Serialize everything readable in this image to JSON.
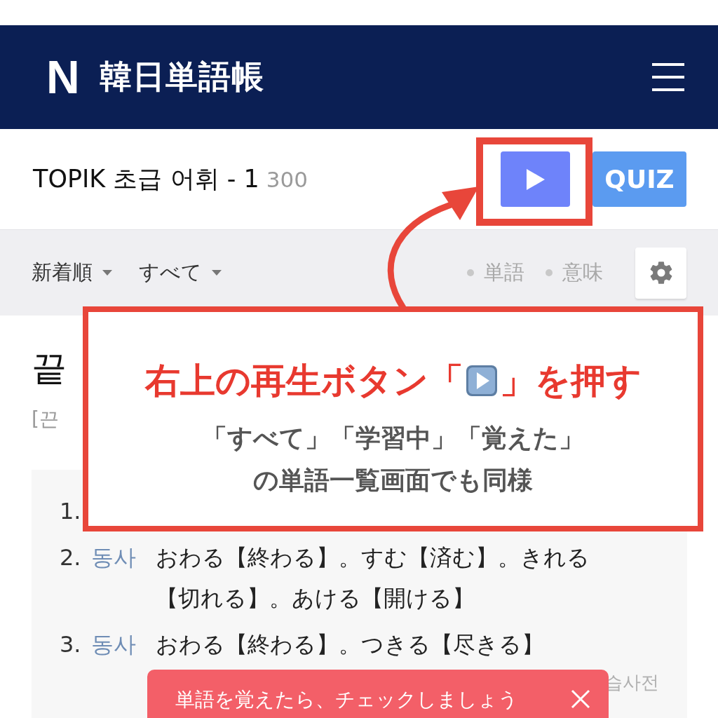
{
  "header": {
    "logo": "N",
    "title": "韓日単語帳"
  },
  "wordbook": {
    "title": "TOPIK 초급 어휘 - 1",
    "count": "300",
    "quiz_button": "QUIZ"
  },
  "filters": {
    "sort": "新着順",
    "status": "すべて",
    "toggles": [
      "単語",
      "意味"
    ]
  },
  "word": {
    "headword": "끝",
    "pronunciation": "[끈"
  },
  "definitions": [
    {
      "number": "1."
    },
    {
      "number": "2.",
      "pos": "동사",
      "meaning": "おわる【終わる】。すむ【済む】。きれる【切れる】。あける【開ける】"
    },
    {
      "number": "3.",
      "pos": "동사",
      "meaning": "おわる【終わる】。つきる【尽きる】"
    }
  ],
  "source": "습사전",
  "toast": {
    "message": "単語を覚えたら、チェックしましょう"
  },
  "callout": {
    "title_parts": [
      "右上の再生ボタン「",
      "」を押す"
    ],
    "note_lines": [
      "「すべて」「学習中」「覚えた」",
      "の単語一覧画面でも同様"
    ]
  }
}
